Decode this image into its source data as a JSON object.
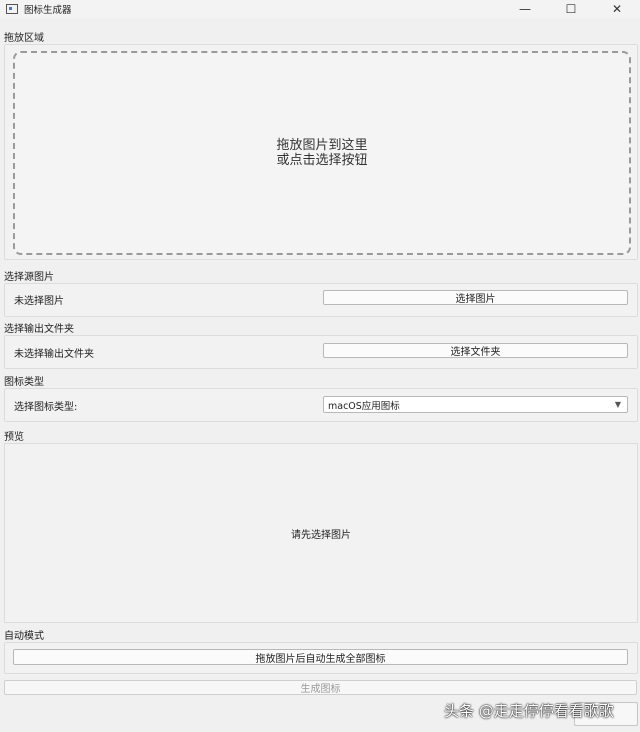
{
  "window": {
    "title": "图标生成器",
    "minimize_glyph": "—",
    "maximize_glyph": "☐",
    "close_glyph": "✕"
  },
  "drop_section": {
    "label": "拖放区域",
    "text": "拖放图片到这里\n或点击选择按钮"
  },
  "image_section": {
    "label": "选择源图片",
    "status": "未选择图片",
    "button": "选择图片"
  },
  "output_section": {
    "label": "选择输出文件夹",
    "status": "未选择输出文件夹",
    "button": "选择文件夹"
  },
  "type_section": {
    "label": "图标类型",
    "field_label": "选择图标类型:",
    "selected": "macOS应用图标"
  },
  "preview_section": {
    "label": "预览",
    "placeholder": "请先选择图片"
  },
  "auto_section": {
    "label": "自动模式",
    "button": "拖放图片后自动生成全部图标"
  },
  "generate_button": "生成图标",
  "watermark": "头条 @走走停停看看歌歌"
}
